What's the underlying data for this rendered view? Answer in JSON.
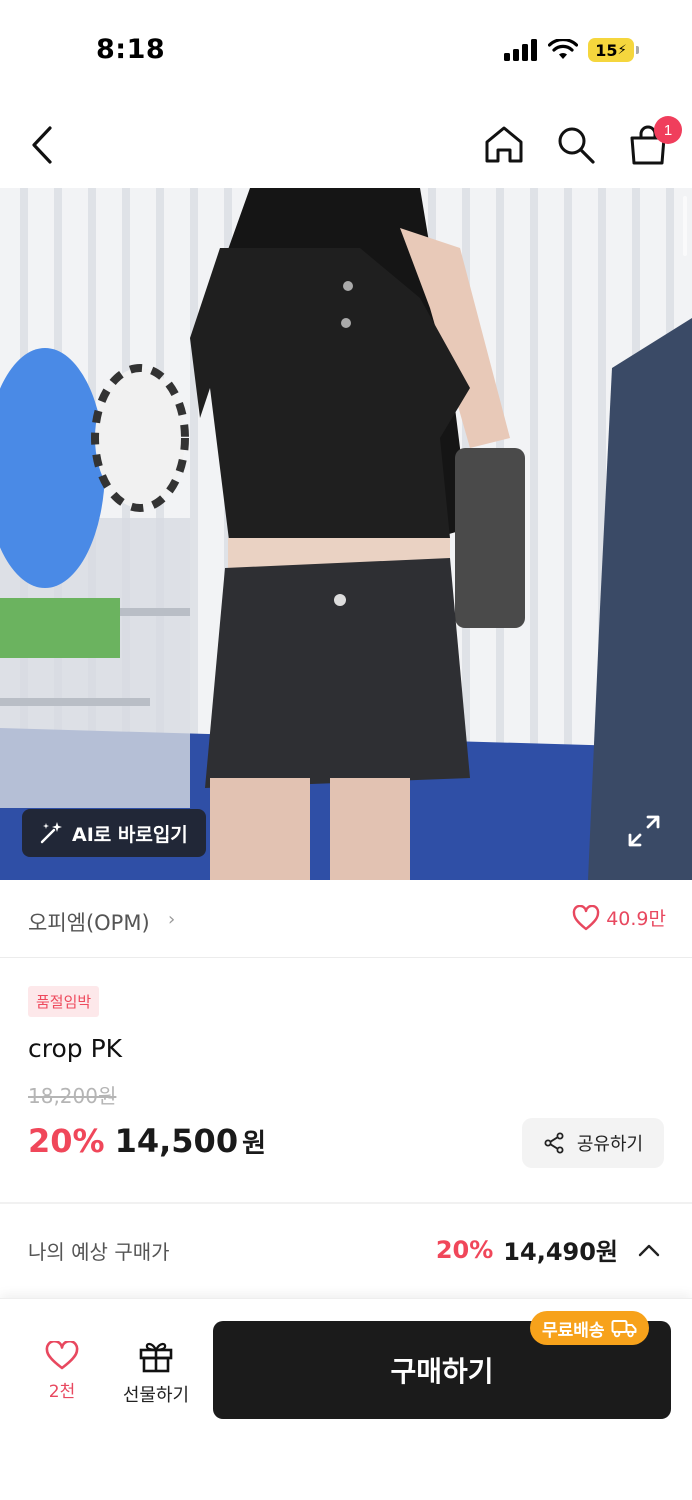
{
  "status_bar": {
    "time": "8:18",
    "battery": "15"
  },
  "nav": {
    "back_icon": "chevron-left-icon",
    "home_icon": "home-icon",
    "search_icon": "search-icon",
    "cart_icon": "shopping-bag-icon",
    "cart_count": "1"
  },
  "image": {
    "ai_tryon_label": "AI로 바로입기",
    "ai_icon": "sparkle-wand-icon",
    "expand_icon": "expand-icon"
  },
  "brand": {
    "name": "오피엠(OPM)",
    "chevron": "›",
    "like_icon": "heart-outline-icon",
    "like_count": "40.9만"
  },
  "product": {
    "status_badge": "품절임박",
    "title": "crop PK",
    "original_price": "18,200원",
    "discount": "20%",
    "sale_price": "14,500",
    "currency": "원",
    "share_label": "공유하기"
  },
  "expected": {
    "label": "나의 예상 구매가",
    "discount": "20%",
    "price": "14,490원"
  },
  "bottom_bar": {
    "wish_count": "2천",
    "gift_label": "선물하기",
    "buy_label": "구매하기",
    "free_shipping_label": "무료배송"
  },
  "colors": {
    "accent_red": "#f0475a",
    "buy_button": "#1b1b1b",
    "free_ship_orange": "#f7a21b",
    "badge_bg": "#fde8ea"
  }
}
